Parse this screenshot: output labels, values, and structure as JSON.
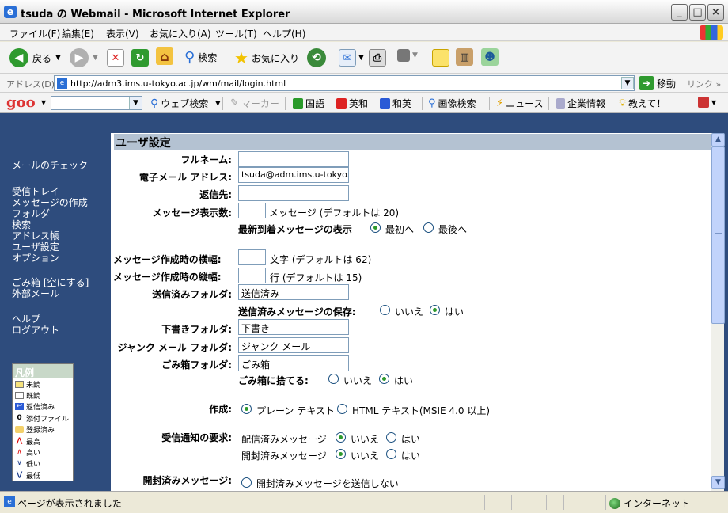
{
  "window": {
    "title": "tsuda の Webmail - Microsoft Internet Explorer"
  },
  "menubar": [
    "ファイル(F)",
    "編集(E)",
    "表示(V)",
    "お気に入り(A)",
    "ツール(T)",
    "ヘルプ(H)"
  ],
  "toolbar": {
    "back": "戻る",
    "search": "検索",
    "favorites": "お気に入り"
  },
  "address": {
    "label": "アドレス(D)",
    "url": "http://adm3.ims.u-tokyo.ac.jp/wm/mail/login.html",
    "go": "移動",
    "links": "リンク"
  },
  "goo": {
    "logo": "goo",
    "items": [
      "ウェブ検索",
      "マーカー",
      "国語",
      "英和",
      "和英",
      "画像検索",
      "ニュース",
      "企業情報",
      "教えて！"
    ]
  },
  "nav": {
    "check": "メールのチェック",
    "inbox": "受信トレイ",
    "compose": "メッセージの作成",
    "folders": "フォルダ",
    "search": "検索",
    "addressbook": "アドレス帳",
    "usersettings": "ユーザ設定",
    "options": "オプション",
    "trash": "ごみ箱 [空にする]",
    "external": "外部メール",
    "help": "ヘルプ",
    "logout": "ログアウト"
  },
  "legend": {
    "title": "凡例",
    "items": [
      "未読",
      "既読",
      "返信済み",
      "添付ファイル",
      "登録済み",
      "最高",
      "高い",
      "低い",
      "最低"
    ]
  },
  "form": {
    "header": "ユーザ設定",
    "fullname_label": "フルネーム:",
    "fullname_value": "",
    "email_label": "電子メール アドレス:",
    "email_value": "tsuda@adm.ims.u-tokyo.ac.jp",
    "replyto_label": "返信先:",
    "replyto_value": "",
    "msgcount_label": "メッセージ表示数:",
    "msgcount_value": "",
    "msgcount_hint": "メッセージ (デフォルトは 20)",
    "newest_label": "最新到着メッセージの表示",
    "newest_first": "最初へ",
    "newest_last": "最後へ",
    "width_label": "メッセージ作成時の横幅:",
    "width_value": "",
    "width_hint": "文字 (デフォルトは 62)",
    "height_label": "メッセージ作成時の縦幅:",
    "height_value": "",
    "height_hint": "行 (デフォルトは 15)",
    "sent_label": "送信済みフォルダ:",
    "sent_value": "送信済み",
    "savesent_label": "送信済みメッセージの保存:",
    "no": "いいえ",
    "yes": "はい",
    "drafts_label": "下書きフォルダ:",
    "drafts_value": "下書き",
    "junk_label": "ジャンク メール フォルダ:",
    "junk_value": "ジャンク メール",
    "trash_label": "ごみ箱フォルダ:",
    "trash_value": "ごみ箱",
    "totrash_label": "ごみ箱に捨てる:",
    "compose_label": "作成:",
    "compose_plain": "プレーン テキスト",
    "compose_html": "HTML テキスト(MSIE 4.0 以上)",
    "receipt_label": "受信通知の要求:",
    "delivered_label": "配信済みメッセージ",
    "read_label": "開封済みメッセージ",
    "opened_label": "開封済みメッセージ:",
    "opened_option": "開封済みメッセージを送信しない"
  },
  "status": {
    "text": "ページが表示されました",
    "zone": "インターネット"
  }
}
